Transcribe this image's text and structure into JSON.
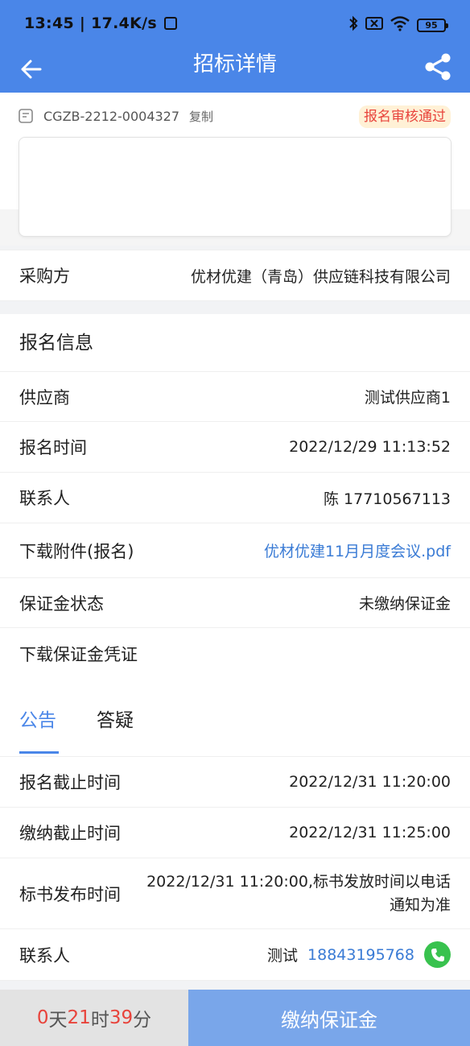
{
  "status_bar": {
    "time": "13:45",
    "network_speed": "17.4K/s",
    "battery": "95",
    "icons": [
      "nfc-icon",
      "bluetooth-icon",
      "signal-off-icon",
      "wifi-icon",
      "battery-icon"
    ]
  },
  "nav": {
    "title": "招标详情",
    "back_icon": "arrow-left-icon",
    "share_icon": "share-icon"
  },
  "colors": {
    "primary": "#4a86e8",
    "link": "#3a7bd5",
    "badge_text": "#e8433b",
    "badge_bg": "#fff1d6",
    "call_green": "#38c24e",
    "button_disabled": "#79a6ea"
  },
  "header": {
    "code": "CGZB-2212-0004327",
    "copy_label": "复制",
    "status_badge": "报名审核通过"
  },
  "buyer": {
    "label": "采购方",
    "value": "优材优建（青岛）供应链科技有限公司"
  },
  "registration": {
    "title": "报名信息",
    "supplier": {
      "label": "供应商",
      "value": "测试供应商1"
    },
    "time": {
      "label": "报名时间",
      "value": "2022/12/29 11:13:52"
    },
    "contact": {
      "label": "联系人",
      "value": "陈 17710567113"
    },
    "attachment": {
      "label": "下载附件(报名)",
      "value": "优材优建11月月度会议.pdf"
    },
    "deposit_status": {
      "label": "保证金状态",
      "value": "未缴纳保证金"
    },
    "deposit_voucher": {
      "label": "下载保证金凭证"
    }
  },
  "tabs": [
    {
      "label": "公告",
      "active": true
    },
    {
      "label": "答疑",
      "active": false
    }
  ],
  "announcement": {
    "reg_deadline": {
      "label": "报名截止时间",
      "value": "2022/12/31 11:20:00"
    },
    "pay_deadline": {
      "label": "缴纳截止时间",
      "value": "2022/12/31 11:25:00"
    },
    "release_time": {
      "label": "标书发布时间",
      "value": "2022/12/31 11:20:00,标书发放时间以电话通知为准"
    },
    "contact": {
      "label": "联系人",
      "name": "测试",
      "phone": "18843195768"
    }
  },
  "countdown": {
    "days": "0",
    "days_unit": "天",
    "hours": "21",
    "hours_unit": "时",
    "minutes": "39",
    "minutes_unit": "分"
  },
  "pay_button": "缴纳保证金"
}
